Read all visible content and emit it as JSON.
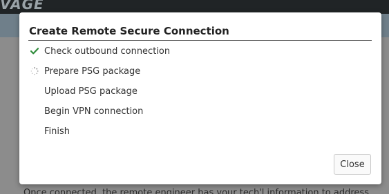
{
  "app": {
    "brand_text": "VAGE"
  },
  "background": {
    "partial_text": "Once connected, the remote engineer has your tech'l information to address"
  },
  "dialog": {
    "title": "Create Remote Secure Connection",
    "steps": [
      {
        "label": "Check outbound connection",
        "status": "done",
        "icon": "check-icon"
      },
      {
        "label": "Prepare PSG package",
        "status": "in-progress",
        "icon": "spinner-icon"
      },
      {
        "label": "Upload PSG package",
        "status": "pending",
        "icon": null
      },
      {
        "label": "Begin VPN connection",
        "status": "pending",
        "icon": null
      },
      {
        "label": "Finish",
        "status": "pending",
        "icon": null
      }
    ],
    "close_label": "Close"
  },
  "colors": {
    "check": "#2e8b3a",
    "spinner": "#8a8a8a",
    "topbar": "#202426",
    "overlay": "#8c8c8c"
  }
}
